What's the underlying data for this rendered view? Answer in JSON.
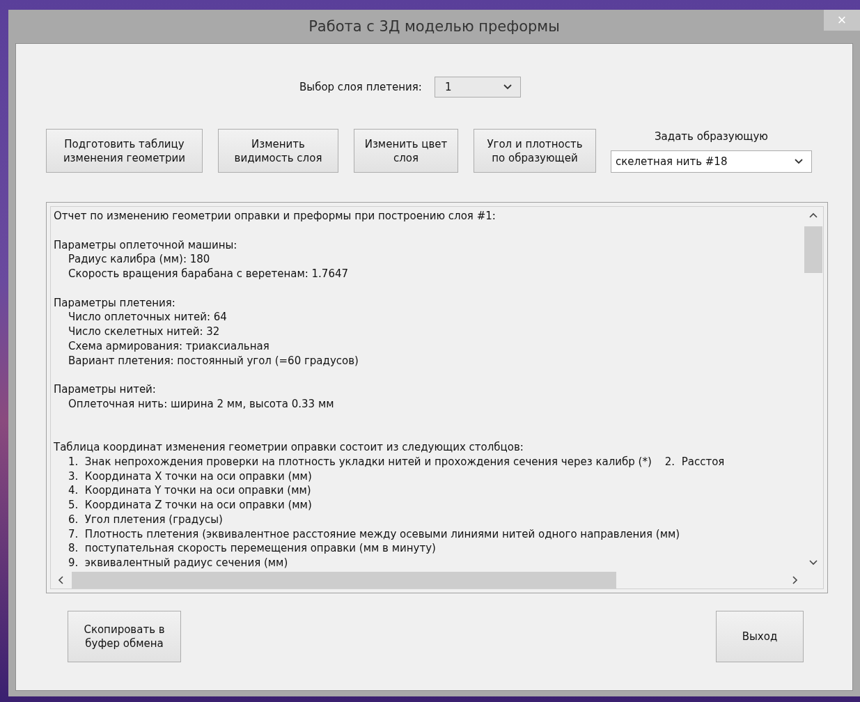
{
  "window": {
    "title": "Работа с 3Д моделью преформы",
    "close": "×"
  },
  "layer_select": {
    "label": "Выбор слоя плетения:",
    "value": "1"
  },
  "buttons": [
    "Подготовить таблицу изменения геометрии",
    "Изменить видимость слоя",
    "Изменить цвет слоя",
    "Угол и плотность по образующей"
  ],
  "generatrix": {
    "label": "Задать образующую",
    "value": "скелетная нить #18"
  },
  "report": {
    "lines": [
      {
        "kind": "heading",
        "text": "Отчет по изменению геометрии оправки и преформы при построению слоя #1:"
      },
      {
        "kind": "gap"
      },
      {
        "kind": "heading",
        "text": "Параметры оплеточной машины:"
      },
      {
        "kind": "item",
        "text": "Радиус калибра (мм): 180"
      },
      {
        "kind": "item",
        "text": "Скорость вращения барабана с веретенам: 1.7647"
      },
      {
        "kind": "gap"
      },
      {
        "kind": "heading",
        "text": "Параметры плетения:"
      },
      {
        "kind": "item",
        "text": "Число оплеточных нитей: 64"
      },
      {
        "kind": "item",
        "text": "Число скелетных нитей: 32"
      },
      {
        "kind": "item",
        "text": "Схема армирования: триаксиальная"
      },
      {
        "kind": "item",
        "text": "Вариант плетения: постоянный угол (=60 градусов)"
      },
      {
        "kind": "gap"
      },
      {
        "kind": "heading",
        "text": "Параметры нитей:"
      },
      {
        "kind": "item",
        "text": "Оплеточная нить: ширина 2 мм, высота 0.33 мм"
      },
      {
        "kind": "gap"
      },
      {
        "kind": "gap"
      },
      {
        "kind": "heading",
        "text": "Таблица координат изменения геометрии оправки состоит из следующих столбцов:"
      },
      {
        "kind": "item",
        "text": "1.  Знак непрохождения проверки на плотность укладки нитей и прохождения сечения через калибр (*)    2.  Расстоя"
      },
      {
        "kind": "item",
        "text": "3.  Координата X точки на оси оправки (мм)"
      },
      {
        "kind": "item",
        "text": "4.  Координата Y точки на оси оправки (мм)"
      },
      {
        "kind": "item",
        "text": "5.  Координата Z точки на оси оправки (мм)"
      },
      {
        "kind": "item",
        "text": "6.  Угол плетения (градусы)"
      },
      {
        "kind": "item",
        "text": "7.  Плотность плетения (эквивалентное расстояние между осевыми линиями нитей одного направления (мм)"
      },
      {
        "kind": "item",
        "text": "8.  поступательная скорость перемещения оправки (мм в минуту)"
      },
      {
        "kind": "item",
        "text": "9.  эквивалентный радиус сечения (мм)"
      }
    ]
  },
  "bottom_buttons": [
    "Скопировать в буфер обмена",
    "Выход"
  ]
}
